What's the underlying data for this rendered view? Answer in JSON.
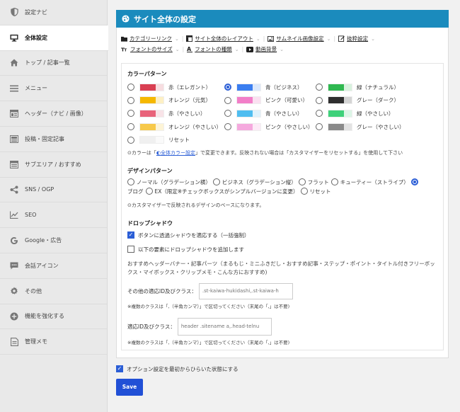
{
  "sidebar": {
    "items": [
      {
        "icon": "shield-half-icon",
        "label": "設定ナビ"
      },
      {
        "icon": "monitor-icon",
        "label": "全体設定",
        "active": true
      },
      {
        "icon": "home-icon",
        "label": "トップ / 記事一覧"
      },
      {
        "icon": "menu-lines-icon",
        "label": "メニュー"
      },
      {
        "icon": "layout-header-icon",
        "label": "ヘッダー（ナビ / 画像）"
      },
      {
        "icon": "post-icon",
        "label": "投稿・固定記事"
      },
      {
        "icon": "sub-area-icon",
        "label": "サブエリア / おすすめ"
      },
      {
        "icon": "share-icon",
        "label": "SNS / OGP"
      },
      {
        "icon": "chart-line-icon",
        "label": "SEO"
      },
      {
        "icon": "google-icon",
        "label": "Google・広告"
      },
      {
        "icon": "chat-icon",
        "label": "会話アイコン"
      },
      {
        "icon": "gear-icon",
        "label": "その他"
      },
      {
        "icon": "plus-circle-icon",
        "label": "機能を強化する"
      },
      {
        "icon": "memo-icon",
        "label": "管理メモ"
      }
    ]
  },
  "header": {
    "title": "サイト全体の設定",
    "icon": "palette-icon"
  },
  "tabs": [
    {
      "icon": "folder-icon",
      "label": "カテゴリーリンク"
    },
    {
      "icon": "layout-icon",
      "label": "サイト全体のレイアウト"
    },
    {
      "icon": "image-icon",
      "label": "サムネイル画像設定"
    },
    {
      "icon": "edit-icon",
      "label": "抜粋設定"
    },
    {
      "icon": "text-size-icon",
      "label": "フォントのサイズ"
    },
    {
      "icon": "font-icon",
      "label": "フォントの種類"
    },
    {
      "icon": "video-icon",
      "label": "動画背景"
    }
  ],
  "color_pattern": {
    "title": "カラーパターン",
    "rows": [
      [
        {
          "label": "赤（エレガント）",
          "colors": [
            "#d93f52",
            "#d93f52",
            "#f7dde0"
          ],
          "checked": false
        },
        {
          "label": "青（ビジネス）",
          "colors": [
            "#3b7ef0",
            "#3b7ef0",
            "#dbe8fc"
          ],
          "checked": true
        },
        {
          "label": "緑（ナチュラル）",
          "colors": [
            "#2fb850",
            "#2fb850",
            "#d8f2de"
          ],
          "checked": false
        }
      ],
      [
        {
          "label": "オレンジ（元気）",
          "colors": [
            "#f5b800",
            "#f5b800",
            "#fdf0c4"
          ],
          "checked": false
        },
        {
          "label": "ピンク（可愛い）",
          "colors": [
            "#f27ec8",
            "#f27ec8",
            "#fbe0f1"
          ],
          "checked": false
        },
        {
          "label": "グレー（ダーク）",
          "colors": [
            "#2f2f2f",
            "#2f2f2f",
            "#d4d4d4"
          ],
          "checked": false
        }
      ],
      [
        {
          "label": "赤（やさしい）",
          "colors": [
            "#e8637a",
            "#e8637a",
            "#f8e3e7"
          ],
          "checked": false
        },
        {
          "label": "青（やさしい）",
          "colors": [
            "#4fbdf0",
            "#4fbdf0",
            "#dff2fc"
          ],
          "checked": false
        },
        {
          "label": "緑（やさしい）",
          "colors": [
            "#3fd17a",
            "#3fd17a",
            "#dcf6e6"
          ],
          "checked": false
        }
      ],
      [
        {
          "label": "オレンジ（やさしい）",
          "colors": [
            "#f7c94a",
            "#f7c94a",
            "#fdf4d6"
          ],
          "checked": false
        },
        {
          "label": "ピンク（やさしい）",
          "colors": [
            "#f5a9de",
            "#f5a9de",
            "#fdeaf7"
          ],
          "checked": false
        },
        {
          "label": "グレー（やさしい）",
          "colors": [
            "#8a8a8a",
            "#8a8a8a",
            "#e2e2e2"
          ],
          "checked": false
        }
      ],
      [
        {
          "label": "リセット",
          "colors": [
            "#f0f0f0",
            "#f0f0f0",
            "#fafafa"
          ],
          "checked": false
        }
      ]
    ],
    "note_prefix": "⊙カラーは「",
    "note_link": "全体カラー設定",
    "note_suffix": "」で変更できます。反映されない場合は「カスタマイザーをリセットする」を使用して下さい"
  },
  "design_pattern": {
    "title": "デザインパターン",
    "options": [
      {
        "label": "ノーマル（グラデーション横）",
        "checked": false
      },
      {
        "label": "ビジネス（グラデーション縦）",
        "checked": false
      },
      {
        "label": "フラット",
        "checked": false
      },
      {
        "label": "キューティー（ストライプ）",
        "checked": false
      },
      {
        "label": "ブログ",
        "checked": true
      },
      {
        "label": "EX（限定※チェックボックスがシンプルバージョンに変更）",
        "checked": false
      },
      {
        "label": "リセット",
        "checked": false
      }
    ],
    "note": "⊙カスタマイザーで反映されるデザインのベースになります。"
  },
  "drop_shadow": {
    "title": "ドロップシャドウ",
    "check1": "ボタンに透過シャドウを適応する（一括強制）",
    "check1_checked": true,
    "check2": "以下の要素にドロップシャドウを追加します",
    "check2_checked": false,
    "recommend": "おすすめヘッダーバナー・記事パーツ（まるもじ・ミニふきだし・おすすめ記事・ステップ・ポイント・タイトル付きフリーボックス・マイボックス・クリップメモ・こんな方におすすめ)",
    "field1_label": "その他の適応ID及びクラス：",
    "field1_placeholder": ".st-kaiwa-hukidashi,.st-kaiwa-h",
    "field1_hint": "※複数のクラスは「,（半角カンマ）」で区切ってください（末尾の「,」は不要)",
    "field2_label": "適応ID及びクラス：",
    "field2_placeholder": "header .sitename a,.head-telnu",
    "field2_hint": "※複数のクラスは「,（半角カンマ）」で区切ってください（末尾の「,」は不要)"
  },
  "bottom": {
    "open_label": "オプション設定を最初からひらいた状態にする",
    "open_checked": true,
    "save_label": "Save"
  },
  "colors": {
    "accent": "#1b8bbd",
    "button": "#2150d6",
    "radio": "#2b5ed6"
  }
}
